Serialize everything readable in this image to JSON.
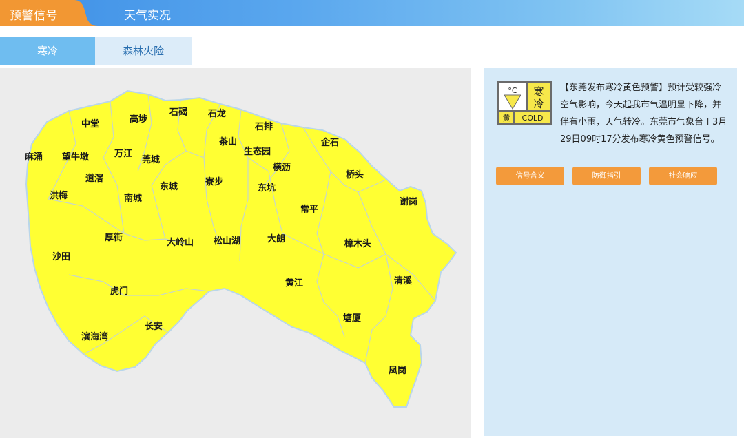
{
  "header": {
    "active_tab": "预警信号",
    "other_tab": "天气实况",
    "active_color": "#f29733"
  },
  "subtabs": [
    {
      "label": "寒冷",
      "active": true
    },
    {
      "label": "森林火险",
      "active": false
    }
  ],
  "map": {
    "fill_color": "#ffff33",
    "regions": [
      "中堂",
      "高埗",
      "石碣",
      "石龙",
      "石排",
      "麻涌",
      "望牛墩",
      "万江",
      "莞城",
      "茶山",
      "生态园",
      "企石",
      "横沥",
      "道滘",
      "东城",
      "寮步",
      "东坑",
      "桥头",
      "洪梅",
      "南城",
      "常平",
      "谢岗",
      "厚街",
      "大岭山",
      "松山湖",
      "大朗",
      "樟木头",
      "沙田",
      "黄江",
      "清溪",
      "虎门",
      "塘厦",
      "长安",
      "滨海湾",
      "凤岗"
    ]
  },
  "warning": {
    "icon": {
      "unit": "°C",
      "char1": "寒",
      "char2": "冷",
      "level": "黄",
      "label": "COLD"
    },
    "text": "【东莞发布寒冷黄色预警】预计受较强冷空气影响，今天起我市气温明显下降，并伴有小雨，天气转冷。东莞市气象台于3月29日09时17分发布寒冷黄色预警信号。"
  },
  "buttons": {
    "meaning": "信号含义",
    "guide": "防御指引",
    "response": "社会响应",
    "color": "#f39a3b"
  }
}
